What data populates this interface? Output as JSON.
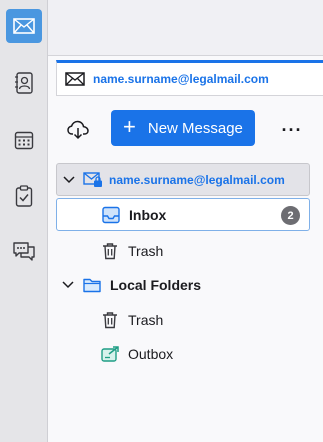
{
  "spaces": [
    {
      "icon": "mail-icon",
      "active": true
    },
    {
      "icon": "address-book-icon",
      "active": false
    },
    {
      "icon": "calendar-icon",
      "active": false
    },
    {
      "icon": "tasks-icon",
      "active": false
    },
    {
      "icon": "chat-icon",
      "active": false
    }
  ],
  "tab": {
    "title": "name.surname@legalmail.com",
    "icon": "mail-icon"
  },
  "toolbar": {
    "new_message_label": "New Message",
    "more_label": "···",
    "get_mail_icon": "cloud-download-icon"
  },
  "folders": {
    "account": {
      "name": "name.surname@legalmail.com",
      "expanded": true
    },
    "inbox": {
      "label": "Inbox",
      "unread": "2"
    },
    "trash": {
      "label": "Trash"
    },
    "local": {
      "label": "Local Folders",
      "expanded": true
    },
    "local_trash": {
      "label": "Trash"
    },
    "outbox": {
      "label": "Outbox"
    }
  },
  "colors": {
    "accent": "#1a73e8",
    "active_space": "#4a97e0",
    "badge": "#6d6d72"
  }
}
